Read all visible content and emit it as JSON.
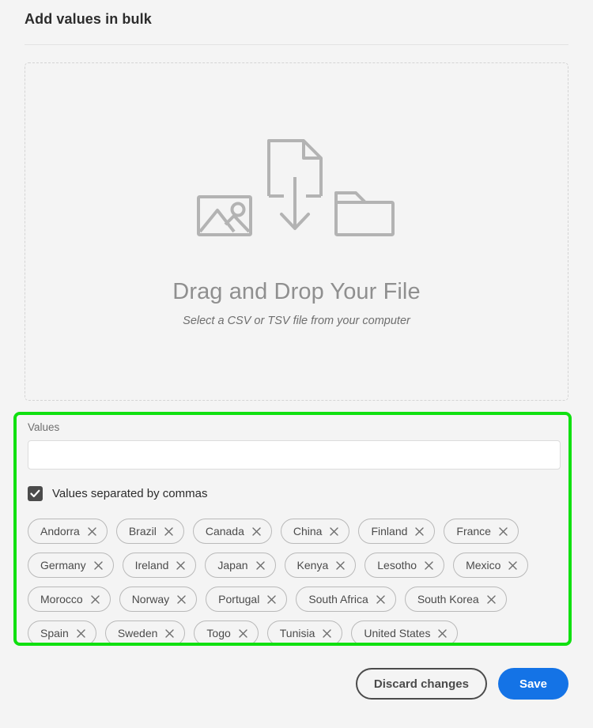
{
  "header": {
    "title": "Add values in bulk"
  },
  "dropzone": {
    "title": "Drag and Drop Your File",
    "subtitle": "Select a CSV or TSV file from your computer",
    "icons": [
      "image-icon",
      "document-download-icon",
      "folder-icon"
    ]
  },
  "values_section": {
    "highlight_color": "#10e010",
    "label": "Values",
    "input_value": "",
    "input_placeholder": "",
    "checkbox": {
      "label": "Values separated by commas",
      "checked": true,
      "color": "#4b4b4b"
    },
    "tags": [
      "Andorra",
      "Brazil",
      "Canada",
      "China",
      "Finland",
      "France",
      "Germany",
      "Ireland",
      "Japan",
      "Kenya",
      "Lesotho",
      "Mexico",
      "Morocco",
      "Norway",
      "Portugal",
      "South Africa",
      "South Korea",
      "Spain",
      "Sweden",
      "Togo",
      "Tunisia",
      "United States"
    ],
    "tag_remove_icon": "close-icon"
  },
  "footer": {
    "discard_label": "Discard changes",
    "save_label": "Save",
    "save_color": "#1473e6"
  }
}
